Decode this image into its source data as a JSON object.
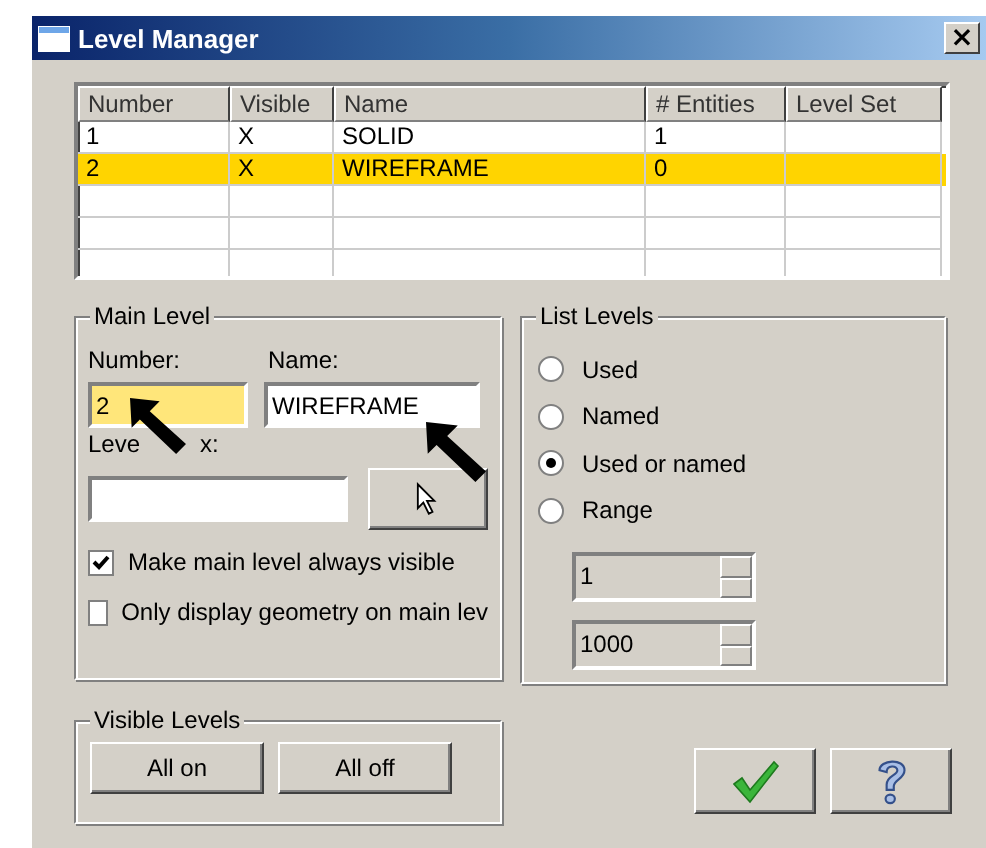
{
  "window": {
    "title": "Level Manager",
    "close": "×"
  },
  "table": {
    "columns": [
      "Number",
      "Visible",
      "Name",
      "# Entities",
      "Level Set"
    ],
    "rows": [
      {
        "number": "1",
        "visible": "X",
        "name": "SOLID",
        "entities": "1",
        "selected": false
      },
      {
        "number": "2",
        "visible": "X",
        "name": "WIREFRAME",
        "entities": "0",
        "selected": true
      }
    ]
  },
  "main_level": {
    "title": "Main Level",
    "number_label": "Number:",
    "number_value": "2",
    "name_label": "Name:",
    "name_value": "WIREFRAME",
    "prefix_label_parts": [
      "Leve",
      "x:"
    ],
    "checkboxes": [
      {
        "label": "Make main level always visible",
        "checked": true
      },
      {
        "label": "Only display geometry on main lev",
        "checked": false
      }
    ]
  },
  "list_levels": {
    "title": "List Levels",
    "options": [
      {
        "label": "Used",
        "selected": false
      },
      {
        "label": "Named",
        "selected": false
      },
      {
        "label": "Used or named",
        "selected": true
      },
      {
        "label": "Range",
        "selected": false
      }
    ],
    "range_fields": [
      {
        "value": "1",
        "disabled": true
      },
      {
        "value": "1000",
        "disabled": true
      }
    ]
  },
  "visible_levels": {
    "title": "Visible Levels",
    "buttons": [
      "All on",
      "All off"
    ]
  }
}
